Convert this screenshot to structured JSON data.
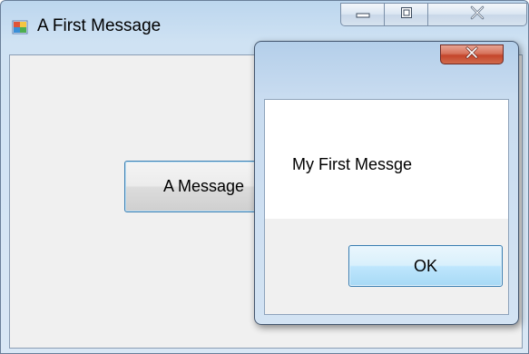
{
  "main_window": {
    "title": "A First Message",
    "icon": "windows-form-icon",
    "caption_buttons": [
      "minimize-icon",
      "maximize-icon",
      "close-icon"
    ],
    "button_label": "A Message"
  },
  "dialog": {
    "message": "My First Messge",
    "ok_label": "OK",
    "close_icon": "close-icon"
  },
  "colors": {
    "close_button": "#c4452b",
    "button_focus_border": "#3c7fb1",
    "client_background": "#f0f0f0"
  }
}
